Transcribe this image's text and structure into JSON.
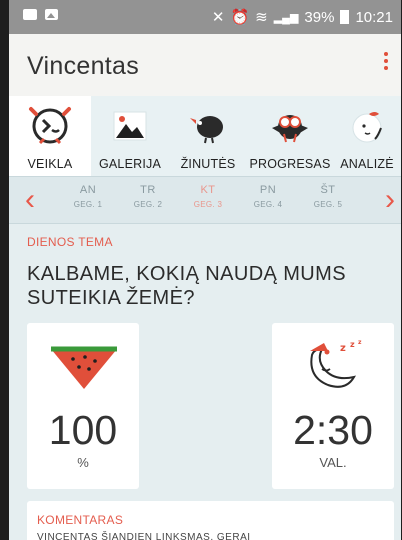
{
  "status_bar": {
    "battery": "39%",
    "time": "10:21"
  },
  "app": {
    "title": "Vincentas"
  },
  "tabs": [
    {
      "label": "VEIKLA",
      "icon": "clock-face-icon",
      "active": true
    },
    {
      "label": "GALERIJA",
      "icon": "image-icon",
      "active": false
    },
    {
      "label": "ŽINUTĖS",
      "icon": "bird-icon",
      "active": false
    },
    {
      "label": "PROGRESAS",
      "icon": "owl-icon",
      "active": false
    },
    {
      "label": "ANALIZĖ",
      "icon": "apple-icon",
      "active": false
    }
  ],
  "days": [
    {
      "day": "AN",
      "week": "GEG. 1",
      "selected": false
    },
    {
      "day": "TR",
      "week": "GEG. 2",
      "selected": false
    },
    {
      "day": "KT",
      "week": "GEG. 3",
      "selected": true
    },
    {
      "day": "PN",
      "week": "GEG. 4",
      "selected": false
    },
    {
      "day": "ŠT",
      "week": "GEG. 5",
      "selected": false
    }
  ],
  "theme": {
    "label": "DIENOS TEMA",
    "text": "KALBAME, KOKIĄ NAUDĄ MUMS SUTEIKIA ŽEMĖ?"
  },
  "cards": [
    {
      "icon": "watermelon-icon",
      "value": "100",
      "unit": "%"
    },
    {
      "icon": "sleeping-moon-icon",
      "value": "2:30",
      "unit": "VAL."
    }
  ],
  "comment": {
    "label": "KOMENTARAS",
    "text": "VINCENTAS ŠIANDIEN LINKSMAS, GERAI"
  },
  "colors": {
    "accent": "#e45d4e",
    "background": "#e5eef0",
    "status_bar": "#939393"
  }
}
